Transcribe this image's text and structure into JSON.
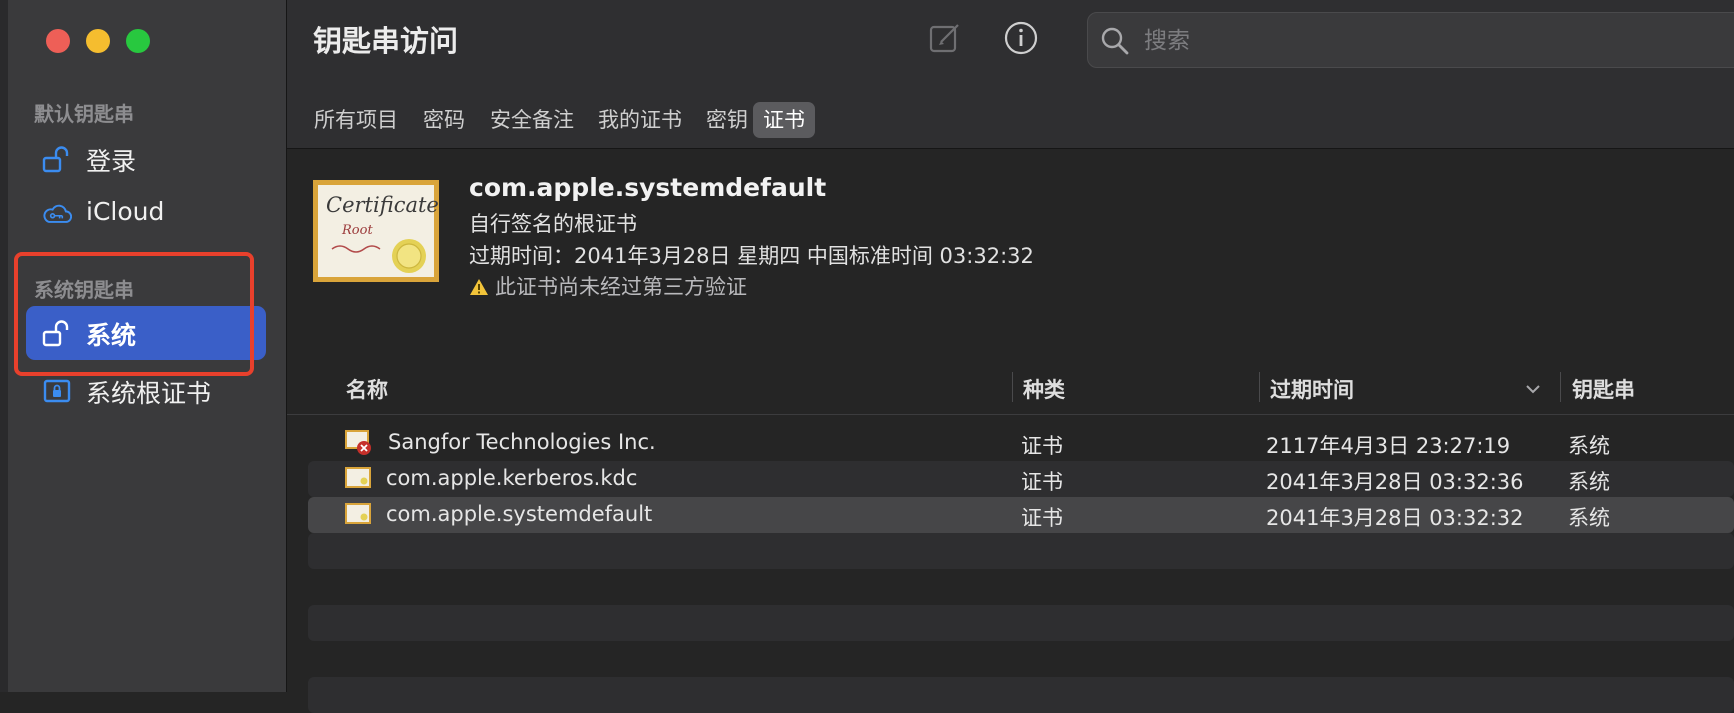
{
  "window": {
    "title": "钥匙串访问"
  },
  "colors": {
    "accent": "#3a5fc8",
    "highlight_box": "#e8402c",
    "close": "#ee5f57",
    "minimize": "#f5bd2f",
    "zoom": "#28c83f"
  },
  "sidebar": {
    "section_default": "默认钥匙串",
    "section_system": "系统钥匙串",
    "items": [
      {
        "label": "登录",
        "icon": "unlock-icon"
      },
      {
        "label": "iCloud",
        "icon": "icloud-icon"
      },
      {
        "label": "系统",
        "icon": "unlock-icon",
        "selected": true
      },
      {
        "label": "系统根证书",
        "icon": "lock-icon"
      }
    ]
  },
  "toolbar": {
    "compose_icon": "compose-icon",
    "info_icon": "info-icon",
    "search": {
      "placeholder": "搜索",
      "value": ""
    }
  },
  "tabs": [
    {
      "label": "所有项目"
    },
    {
      "label": "密码"
    },
    {
      "label": "安全备注"
    },
    {
      "label": "我的证书"
    },
    {
      "label": "密钥"
    },
    {
      "label": "证书",
      "active": true
    }
  ],
  "detail": {
    "name": "com.apple.systemdefault",
    "type": "自行签名的根证书",
    "expiry": "过期时间：2041年3月28日 星期四 中国标准时间 03:32:32",
    "warning": "此证书尚未经过第三方验证",
    "cert_image_text_1": "Certificate",
    "cert_image_text_2": "Root"
  },
  "table": {
    "columns": [
      "名称",
      "种类",
      "过期时间",
      "钥匙串"
    ],
    "sort_column": "过期时间",
    "rows": [
      {
        "name": "Sangfor Technologies Inc.",
        "kind": "证书",
        "expires": "2117年4月3日 23:27:19",
        "keychain": "系统",
        "invalid": true
      },
      {
        "name": "com.apple.kerberos.kdc",
        "kind": "证书",
        "expires": "2041年3月28日 03:32:36",
        "keychain": "系统"
      },
      {
        "name": "com.apple.systemdefault",
        "kind": "证书",
        "expires": "2041年3月28日 03:32:32",
        "keychain": "系统",
        "selected": true
      }
    ]
  }
}
